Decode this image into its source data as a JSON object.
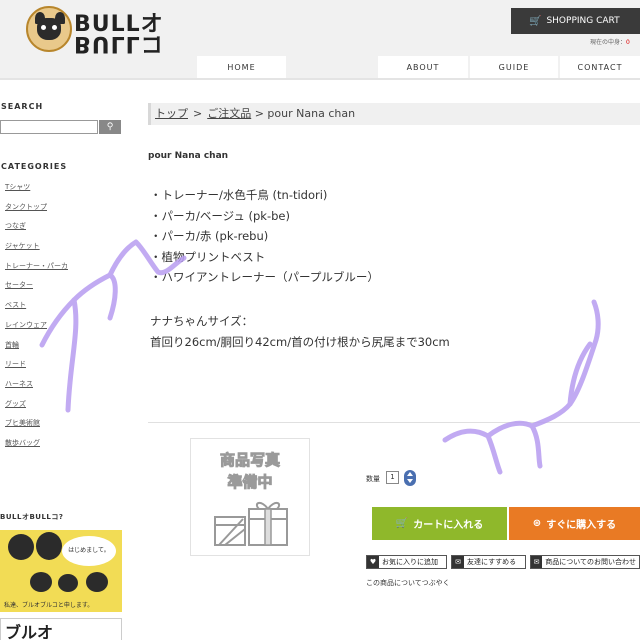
{
  "brand": {
    "name_top": "BULLオ",
    "name_bottom": "BULLコ"
  },
  "header": {
    "cart_label": "SHOPPING CART",
    "current_label": "現在の中身：",
    "current_count": "0"
  },
  "nav": {
    "items": [
      {
        "label": "HOME"
      },
      {
        "label": "ABOUT"
      },
      {
        "label": "GUIDE"
      },
      {
        "label": "CONTACT"
      }
    ]
  },
  "sidebar": {
    "search_title": "SEARCH",
    "search_value": "",
    "categories_title": "CATEGORIES",
    "categories": [
      "Tシャツ",
      "タンクトップ",
      "つなぎ",
      "ジャケット",
      "トレーナー・パーカ",
      "セーター",
      "ベスト",
      "レインウェア",
      "首輪",
      "リード",
      "ハーネス",
      "グッズ",
      "ブヒ美術館",
      "散歩バッグ"
    ],
    "about_title": "BULLオBULLコ?",
    "about_bubble": "はじめまして。",
    "about_caption": "私達、ブルオブルコと申します。",
    "banner_text": "ブルオ"
  },
  "breadcrumb": {
    "home": "トップ",
    "sep1": ">",
    "category": "ご注文品",
    "current": "> pour Nana chan"
  },
  "product": {
    "title": "pour Nana chan",
    "items": [
      "・トレーナー/水色千鳥 (tn-tidori)",
      "・パーカ/ベージュ (pk-be)",
      "・パーカ/赤 (pk-rebu)",
      "・植物プリントベスト",
      "・ハワイアントレーナー（パープルブルー）"
    ],
    "size_heading": "ナナちゃんサイズ：",
    "size_detail": "首回り26cm/胴回り42cm/首の付け根から尻尾まで30cm",
    "photo_line1": "商品写真",
    "photo_line2": "準備中",
    "qty_label": "数量",
    "qty_value": "1",
    "add_to_cart": "カートに入れる",
    "buy_now": "すぐに購入する",
    "favorite": "お気に入りに追加",
    "recommend": "友達にすすめる",
    "inquiry": "商品についてのお問い合わせ",
    "tweet": "この商品についてつぶやく"
  },
  "colors": {
    "cart_green": "#8fb82b",
    "buy_orange": "#e97a24",
    "scribble": "#b79cf0"
  }
}
